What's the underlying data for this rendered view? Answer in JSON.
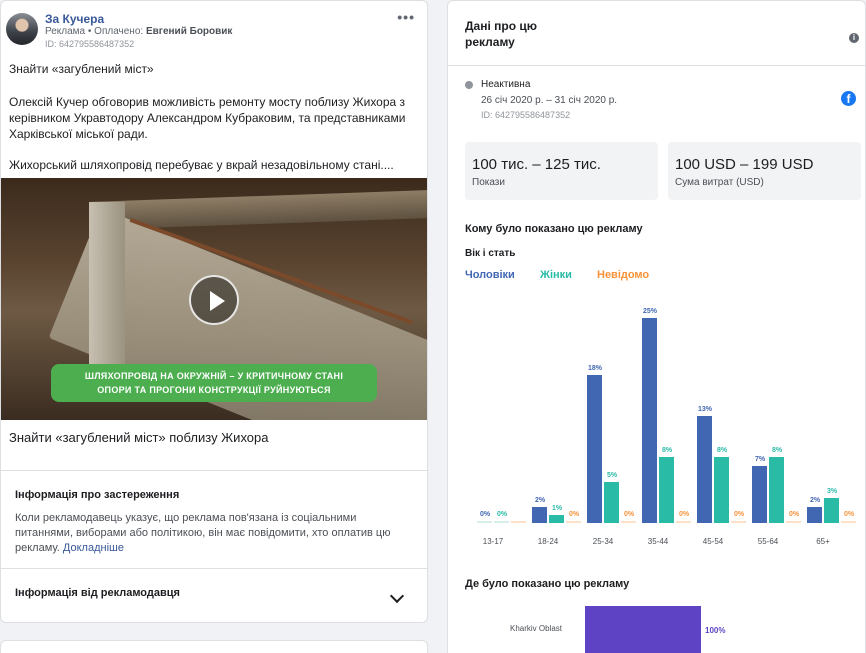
{
  "ad": {
    "page_name": "За Кучера",
    "sponsor_prefix": "Реклама • Оплачено:",
    "sponsor_name": "Евгений Боровик",
    "id_label": "ID: 642795586487352",
    "text_1": "Знайти «загублений міст»",
    "text_2": "Олексій Кучер обговорив можливість ремонту мосту поблизу Жихора з керівником Укравтодору Александром Кубраковим, та представниками Харківської міської ради.",
    "text_3": "Жихорський шляхопровід перебуває у вкрай незадовільному стані....",
    "video_caption_1": "ШЛЯХОПРОВІД НА ОКРУЖНІЙ – У КРИТИЧНОМУ СТАНІ",
    "video_caption_2": "ОПОРИ ТА ПРОГОНИ КОНСТРУКЦІЇ РУЙНУЮТЬСЯ",
    "link_title": "Знайти «загублений міст» поблизу Жихора"
  },
  "disclaimer": {
    "title": "Інформація про застереження",
    "text": "Коли рекламодавець указує, що реклама пов'язана із соціальними питаннями, виборами або політикою, він має повідомити, хто оплатив цю рекламу.",
    "more_link": "Докладніше"
  },
  "advertiser": {
    "title": "Інформація від рекламодавця"
  },
  "details": {
    "title": "Дані про цю рекламу",
    "status": "Неактивна",
    "dates": "26 січ 2020 р. – 31 січ 2020 р.",
    "id_label": "ID: 642795586487352",
    "impressions_value": "100 тис. – 125 тис.",
    "impressions_label": "Покази",
    "spend_value": "100 USD – 199 USD",
    "spend_label": "Сума витрат (USD)",
    "shown_to_title": "Кому було показано цю рекламу",
    "age_gender_title": "Вік і стать",
    "where_title": "Де було показано цю рекламу"
  },
  "colors": {
    "men": "#4267b2",
    "women": "#2abba7",
    "unknown": "#f7923b",
    "region": "#5e44c4"
  },
  "chart_data": {
    "type": "bar",
    "legend": [
      "Чоловіки",
      "Жінки",
      "Невідомо"
    ],
    "categories": [
      "13-17",
      "18-24",
      "25-34",
      "35-44",
      "45-54",
      "55-64",
      "65+"
    ],
    "series": [
      {
        "name": "Чоловіки",
        "values": [
          0,
          2,
          18,
          25,
          13,
          7,
          2
        ],
        "labels": [
          "0%",
          "2%",
          "18%",
          "25%",
          "13%",
          "7%",
          "2%"
        ]
      },
      {
        "name": "Жінки",
        "values": [
          0,
          1,
          5,
          8,
          8,
          8,
          3
        ],
        "labels": [
          "0%",
          "1%",
          "5%",
          "8%",
          "8%",
          "8%",
          "3%"
        ]
      },
      {
        "name": "Невідомо",
        "values": [
          0,
          0,
          0,
          0,
          0,
          0,
          0
        ],
        "labels": [
          "",
          "0%",
          "0%",
          "0%",
          "0%",
          "0%",
          "0%"
        ]
      }
    ],
    "ylim": [
      0,
      25
    ]
  },
  "region_data": {
    "type": "bar",
    "categories": [
      "Kharkiv Oblast"
    ],
    "values": [
      100
    ],
    "label": "100%"
  }
}
